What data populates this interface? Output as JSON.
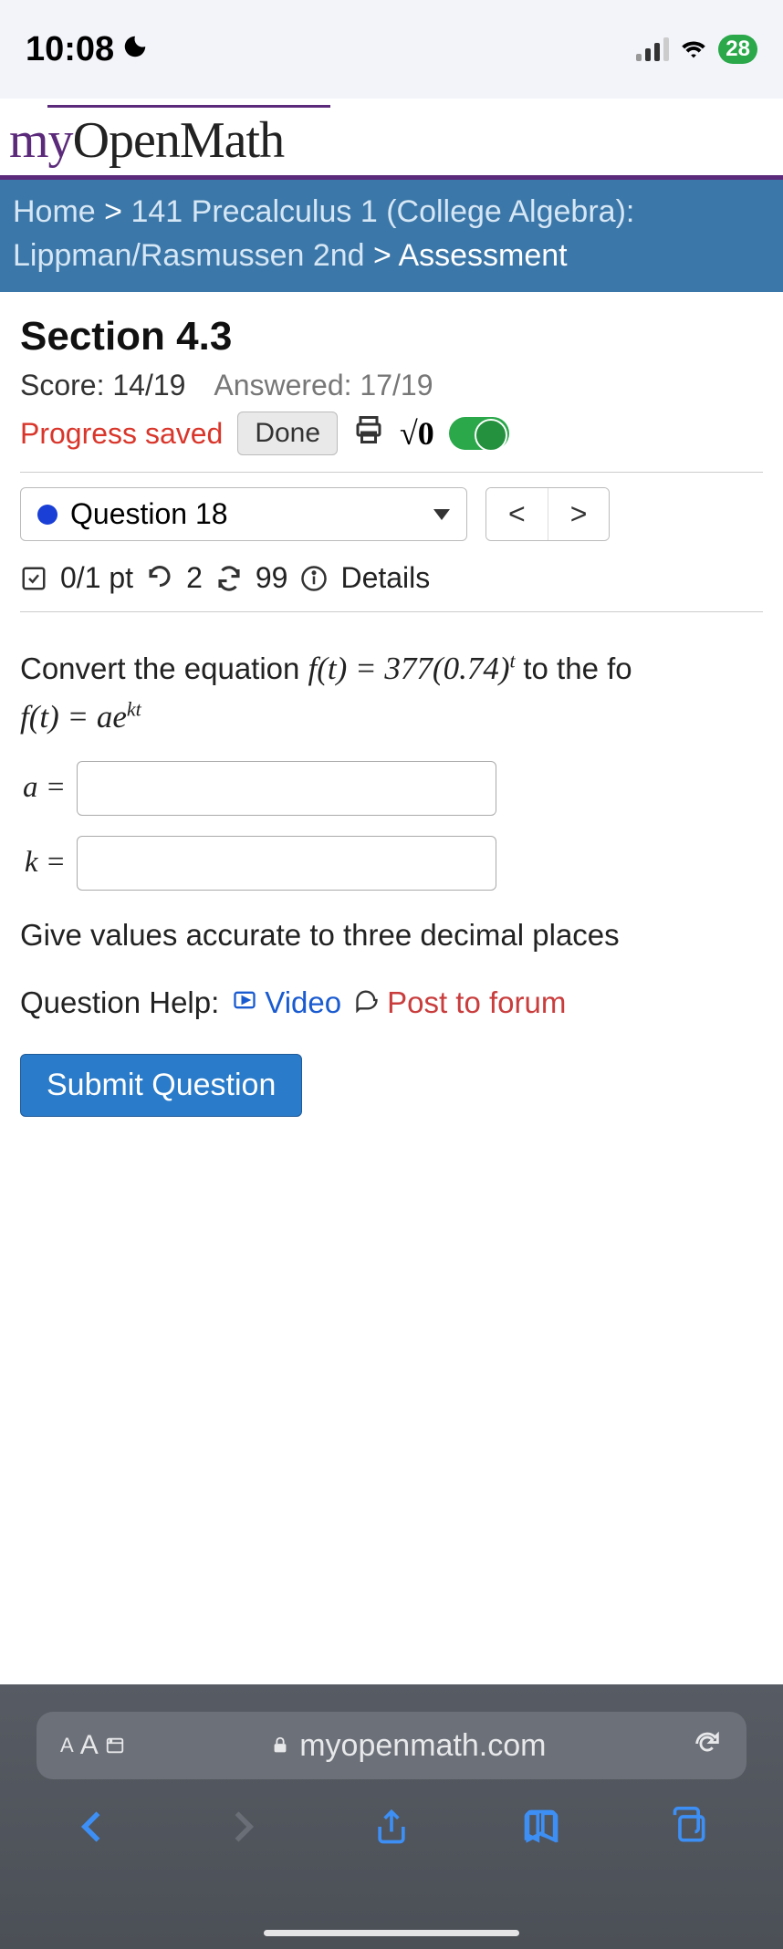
{
  "status": {
    "time": "10:08",
    "battery": "28"
  },
  "logo": {
    "my": "my",
    "rest": "OpenMath"
  },
  "breadcrumb": {
    "home": "Home",
    "sep": ">",
    "course": "141 Precalculus 1 (College Algebra): Lippman/Rasmussen 2nd",
    "current": "Assessment"
  },
  "section": {
    "title": "Section 4.3",
    "score_label": "Score: 14/19",
    "answered_label": "Answered: 17/19",
    "progress_saved": "Progress saved",
    "done": "Done",
    "sqrt": "√0"
  },
  "question_nav": {
    "label": "Question 18",
    "prev": "<",
    "next": ">"
  },
  "question_meta": {
    "points": "0/1 pt",
    "attempts": "2",
    "regen": "99",
    "details": "Details"
  },
  "question": {
    "prompt_prefix": "Convert the equation ",
    "eq1": "f(t) = 377(0.74)",
    "eq1_sup": "t",
    "prompt_suffix": " to the fo",
    "eq2_a": "f(t) = ae",
    "eq2_sup": "kt",
    "a_label": "a =",
    "k_label": "k =",
    "hint": "Give values accurate to three decimal places",
    "help_label": "Question Help:",
    "video": "Video",
    "forum": "Post to forum",
    "submit": "Submit Question"
  },
  "browser": {
    "aa": "AA",
    "domain": "myopenmath.com"
  }
}
